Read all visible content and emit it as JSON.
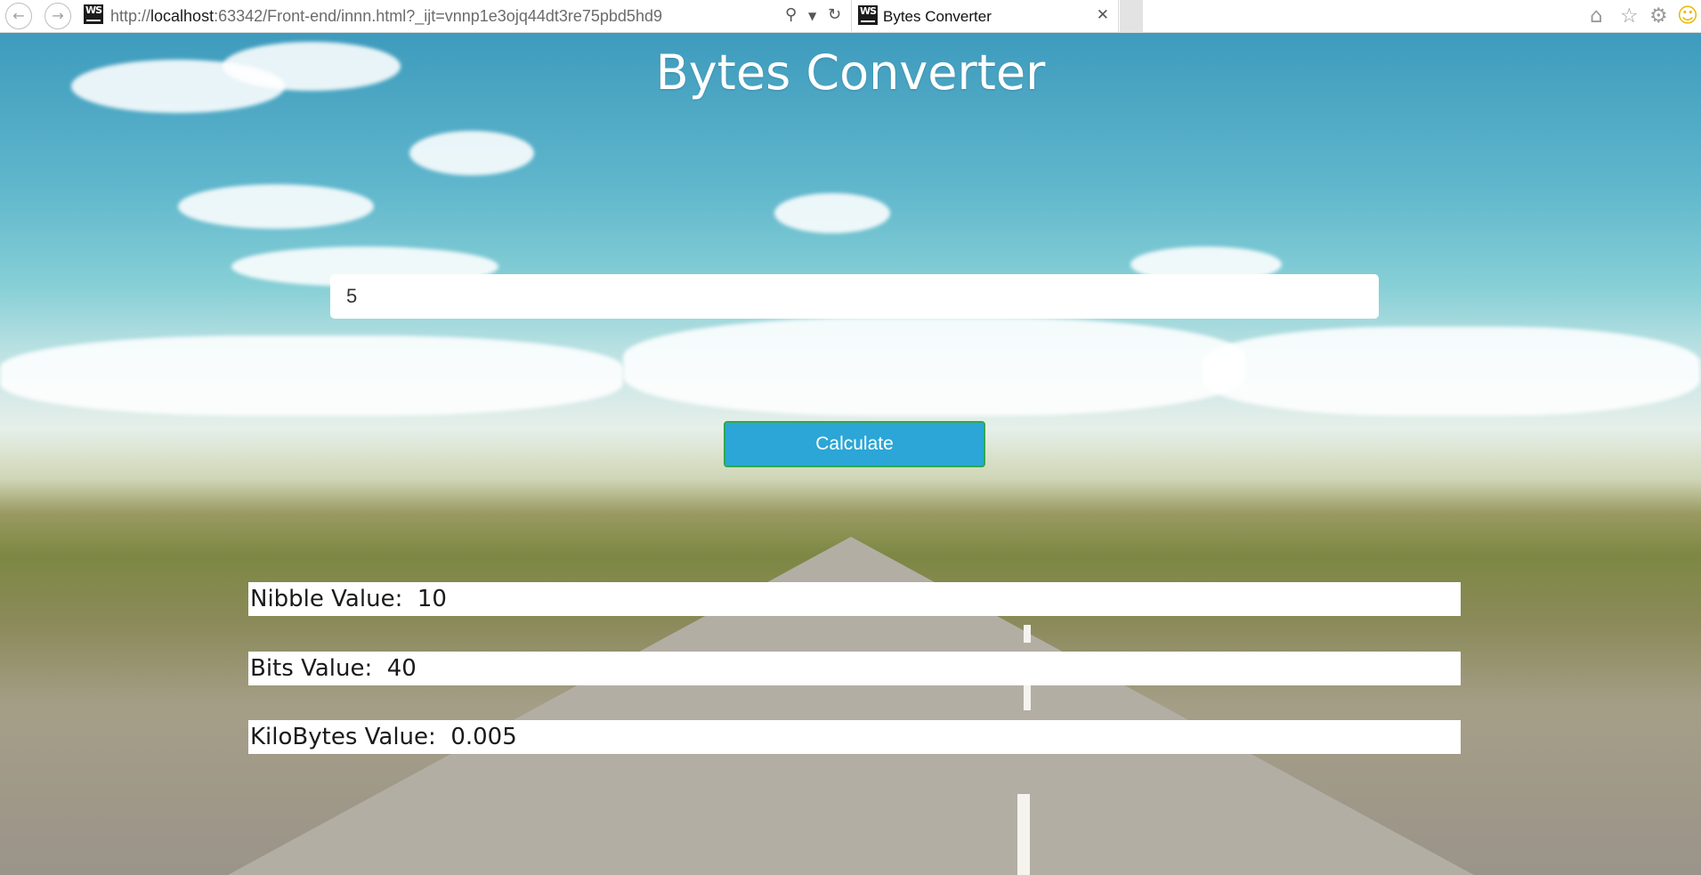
{
  "browser": {
    "url_prefix": "http://",
    "url_host": "localhost",
    "url_rest": ":63342/Front-end/innn.html?_ijt=vnnp1e3ojq44dt3re75pbd5hd9",
    "tab_title": "Bytes Converter",
    "icons": {
      "back": "back-arrow-icon",
      "forward": "forward-arrow-icon",
      "site": "webstorm-icon",
      "search": "search-icon",
      "dropdown": "chevron-down-icon",
      "refresh": "refresh-icon",
      "close": "close-icon",
      "home": "home-icon",
      "favorites": "star-icon",
      "settings": "gear-icon",
      "feedback": "smiley-icon"
    }
  },
  "app": {
    "title": "Bytes Converter",
    "input_value": "5",
    "calculate_label": "Calculate",
    "results": [
      {
        "label": "Nibble Value:",
        "value": "10"
      },
      {
        "label": "Bits Value:",
        "value": "40"
      },
      {
        "label": "KiloBytes Value:",
        "value": "0.005"
      }
    ]
  },
  "colors": {
    "button_bg": "#2ba6d6",
    "button_border": "#2fa84f",
    "title_text": "#ffffff"
  }
}
